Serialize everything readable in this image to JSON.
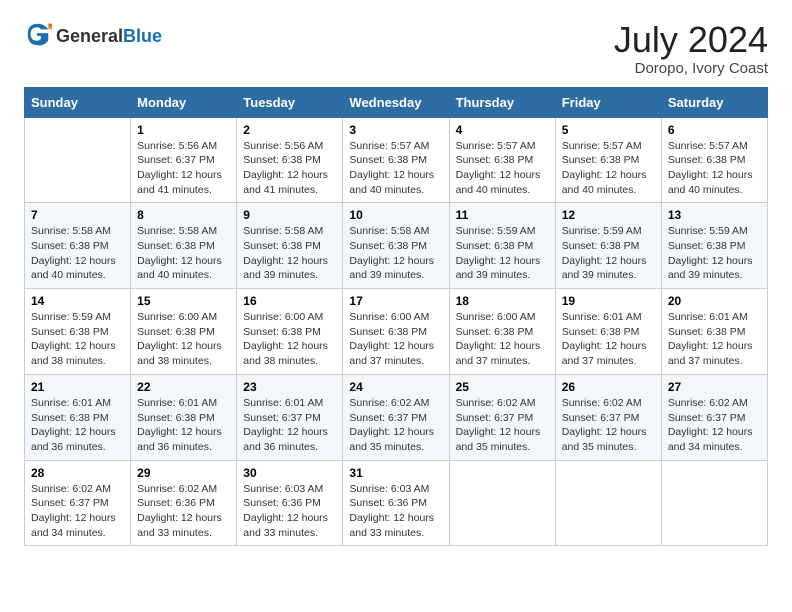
{
  "header": {
    "logo_general": "General",
    "logo_blue": "Blue",
    "title": "July 2024",
    "subtitle": "Doropo, Ivory Coast"
  },
  "days_of_week": [
    "Sunday",
    "Monday",
    "Tuesday",
    "Wednesday",
    "Thursday",
    "Friday",
    "Saturday"
  ],
  "weeks": [
    [
      {
        "day": "",
        "info": ""
      },
      {
        "day": "1",
        "info": "Sunrise: 5:56 AM\nSunset: 6:37 PM\nDaylight: 12 hours\nand 41 minutes."
      },
      {
        "day": "2",
        "info": "Sunrise: 5:56 AM\nSunset: 6:38 PM\nDaylight: 12 hours\nand 41 minutes."
      },
      {
        "day": "3",
        "info": "Sunrise: 5:57 AM\nSunset: 6:38 PM\nDaylight: 12 hours\nand 40 minutes."
      },
      {
        "day": "4",
        "info": "Sunrise: 5:57 AM\nSunset: 6:38 PM\nDaylight: 12 hours\nand 40 minutes."
      },
      {
        "day": "5",
        "info": "Sunrise: 5:57 AM\nSunset: 6:38 PM\nDaylight: 12 hours\nand 40 minutes."
      },
      {
        "day": "6",
        "info": "Sunrise: 5:57 AM\nSunset: 6:38 PM\nDaylight: 12 hours\nand 40 minutes."
      }
    ],
    [
      {
        "day": "7",
        "info": "Sunrise: 5:58 AM\nSunset: 6:38 PM\nDaylight: 12 hours\nand 40 minutes."
      },
      {
        "day": "8",
        "info": "Sunrise: 5:58 AM\nSunset: 6:38 PM\nDaylight: 12 hours\nand 40 minutes."
      },
      {
        "day": "9",
        "info": "Sunrise: 5:58 AM\nSunset: 6:38 PM\nDaylight: 12 hours\nand 39 minutes."
      },
      {
        "day": "10",
        "info": "Sunrise: 5:58 AM\nSunset: 6:38 PM\nDaylight: 12 hours\nand 39 minutes."
      },
      {
        "day": "11",
        "info": "Sunrise: 5:59 AM\nSunset: 6:38 PM\nDaylight: 12 hours\nand 39 minutes."
      },
      {
        "day": "12",
        "info": "Sunrise: 5:59 AM\nSunset: 6:38 PM\nDaylight: 12 hours\nand 39 minutes."
      },
      {
        "day": "13",
        "info": "Sunrise: 5:59 AM\nSunset: 6:38 PM\nDaylight: 12 hours\nand 39 minutes."
      }
    ],
    [
      {
        "day": "14",
        "info": "Sunrise: 5:59 AM\nSunset: 6:38 PM\nDaylight: 12 hours\nand 38 minutes."
      },
      {
        "day": "15",
        "info": "Sunrise: 6:00 AM\nSunset: 6:38 PM\nDaylight: 12 hours\nand 38 minutes."
      },
      {
        "day": "16",
        "info": "Sunrise: 6:00 AM\nSunset: 6:38 PM\nDaylight: 12 hours\nand 38 minutes."
      },
      {
        "day": "17",
        "info": "Sunrise: 6:00 AM\nSunset: 6:38 PM\nDaylight: 12 hours\nand 37 minutes."
      },
      {
        "day": "18",
        "info": "Sunrise: 6:00 AM\nSunset: 6:38 PM\nDaylight: 12 hours\nand 37 minutes."
      },
      {
        "day": "19",
        "info": "Sunrise: 6:01 AM\nSunset: 6:38 PM\nDaylight: 12 hours\nand 37 minutes."
      },
      {
        "day": "20",
        "info": "Sunrise: 6:01 AM\nSunset: 6:38 PM\nDaylight: 12 hours\nand 37 minutes."
      }
    ],
    [
      {
        "day": "21",
        "info": "Sunrise: 6:01 AM\nSunset: 6:38 PM\nDaylight: 12 hours\nand 36 minutes."
      },
      {
        "day": "22",
        "info": "Sunrise: 6:01 AM\nSunset: 6:38 PM\nDaylight: 12 hours\nand 36 minutes."
      },
      {
        "day": "23",
        "info": "Sunrise: 6:01 AM\nSunset: 6:37 PM\nDaylight: 12 hours\nand 36 minutes."
      },
      {
        "day": "24",
        "info": "Sunrise: 6:02 AM\nSunset: 6:37 PM\nDaylight: 12 hours\nand 35 minutes."
      },
      {
        "day": "25",
        "info": "Sunrise: 6:02 AM\nSunset: 6:37 PM\nDaylight: 12 hours\nand 35 minutes."
      },
      {
        "day": "26",
        "info": "Sunrise: 6:02 AM\nSunset: 6:37 PM\nDaylight: 12 hours\nand 35 minutes."
      },
      {
        "day": "27",
        "info": "Sunrise: 6:02 AM\nSunset: 6:37 PM\nDaylight: 12 hours\nand 34 minutes."
      }
    ],
    [
      {
        "day": "28",
        "info": "Sunrise: 6:02 AM\nSunset: 6:37 PM\nDaylight: 12 hours\nand 34 minutes."
      },
      {
        "day": "29",
        "info": "Sunrise: 6:02 AM\nSunset: 6:36 PM\nDaylight: 12 hours\nand 33 minutes."
      },
      {
        "day": "30",
        "info": "Sunrise: 6:03 AM\nSunset: 6:36 PM\nDaylight: 12 hours\nand 33 minutes."
      },
      {
        "day": "31",
        "info": "Sunrise: 6:03 AM\nSunset: 6:36 PM\nDaylight: 12 hours\nand 33 minutes."
      },
      {
        "day": "",
        "info": ""
      },
      {
        "day": "",
        "info": ""
      },
      {
        "day": "",
        "info": ""
      }
    ]
  ]
}
